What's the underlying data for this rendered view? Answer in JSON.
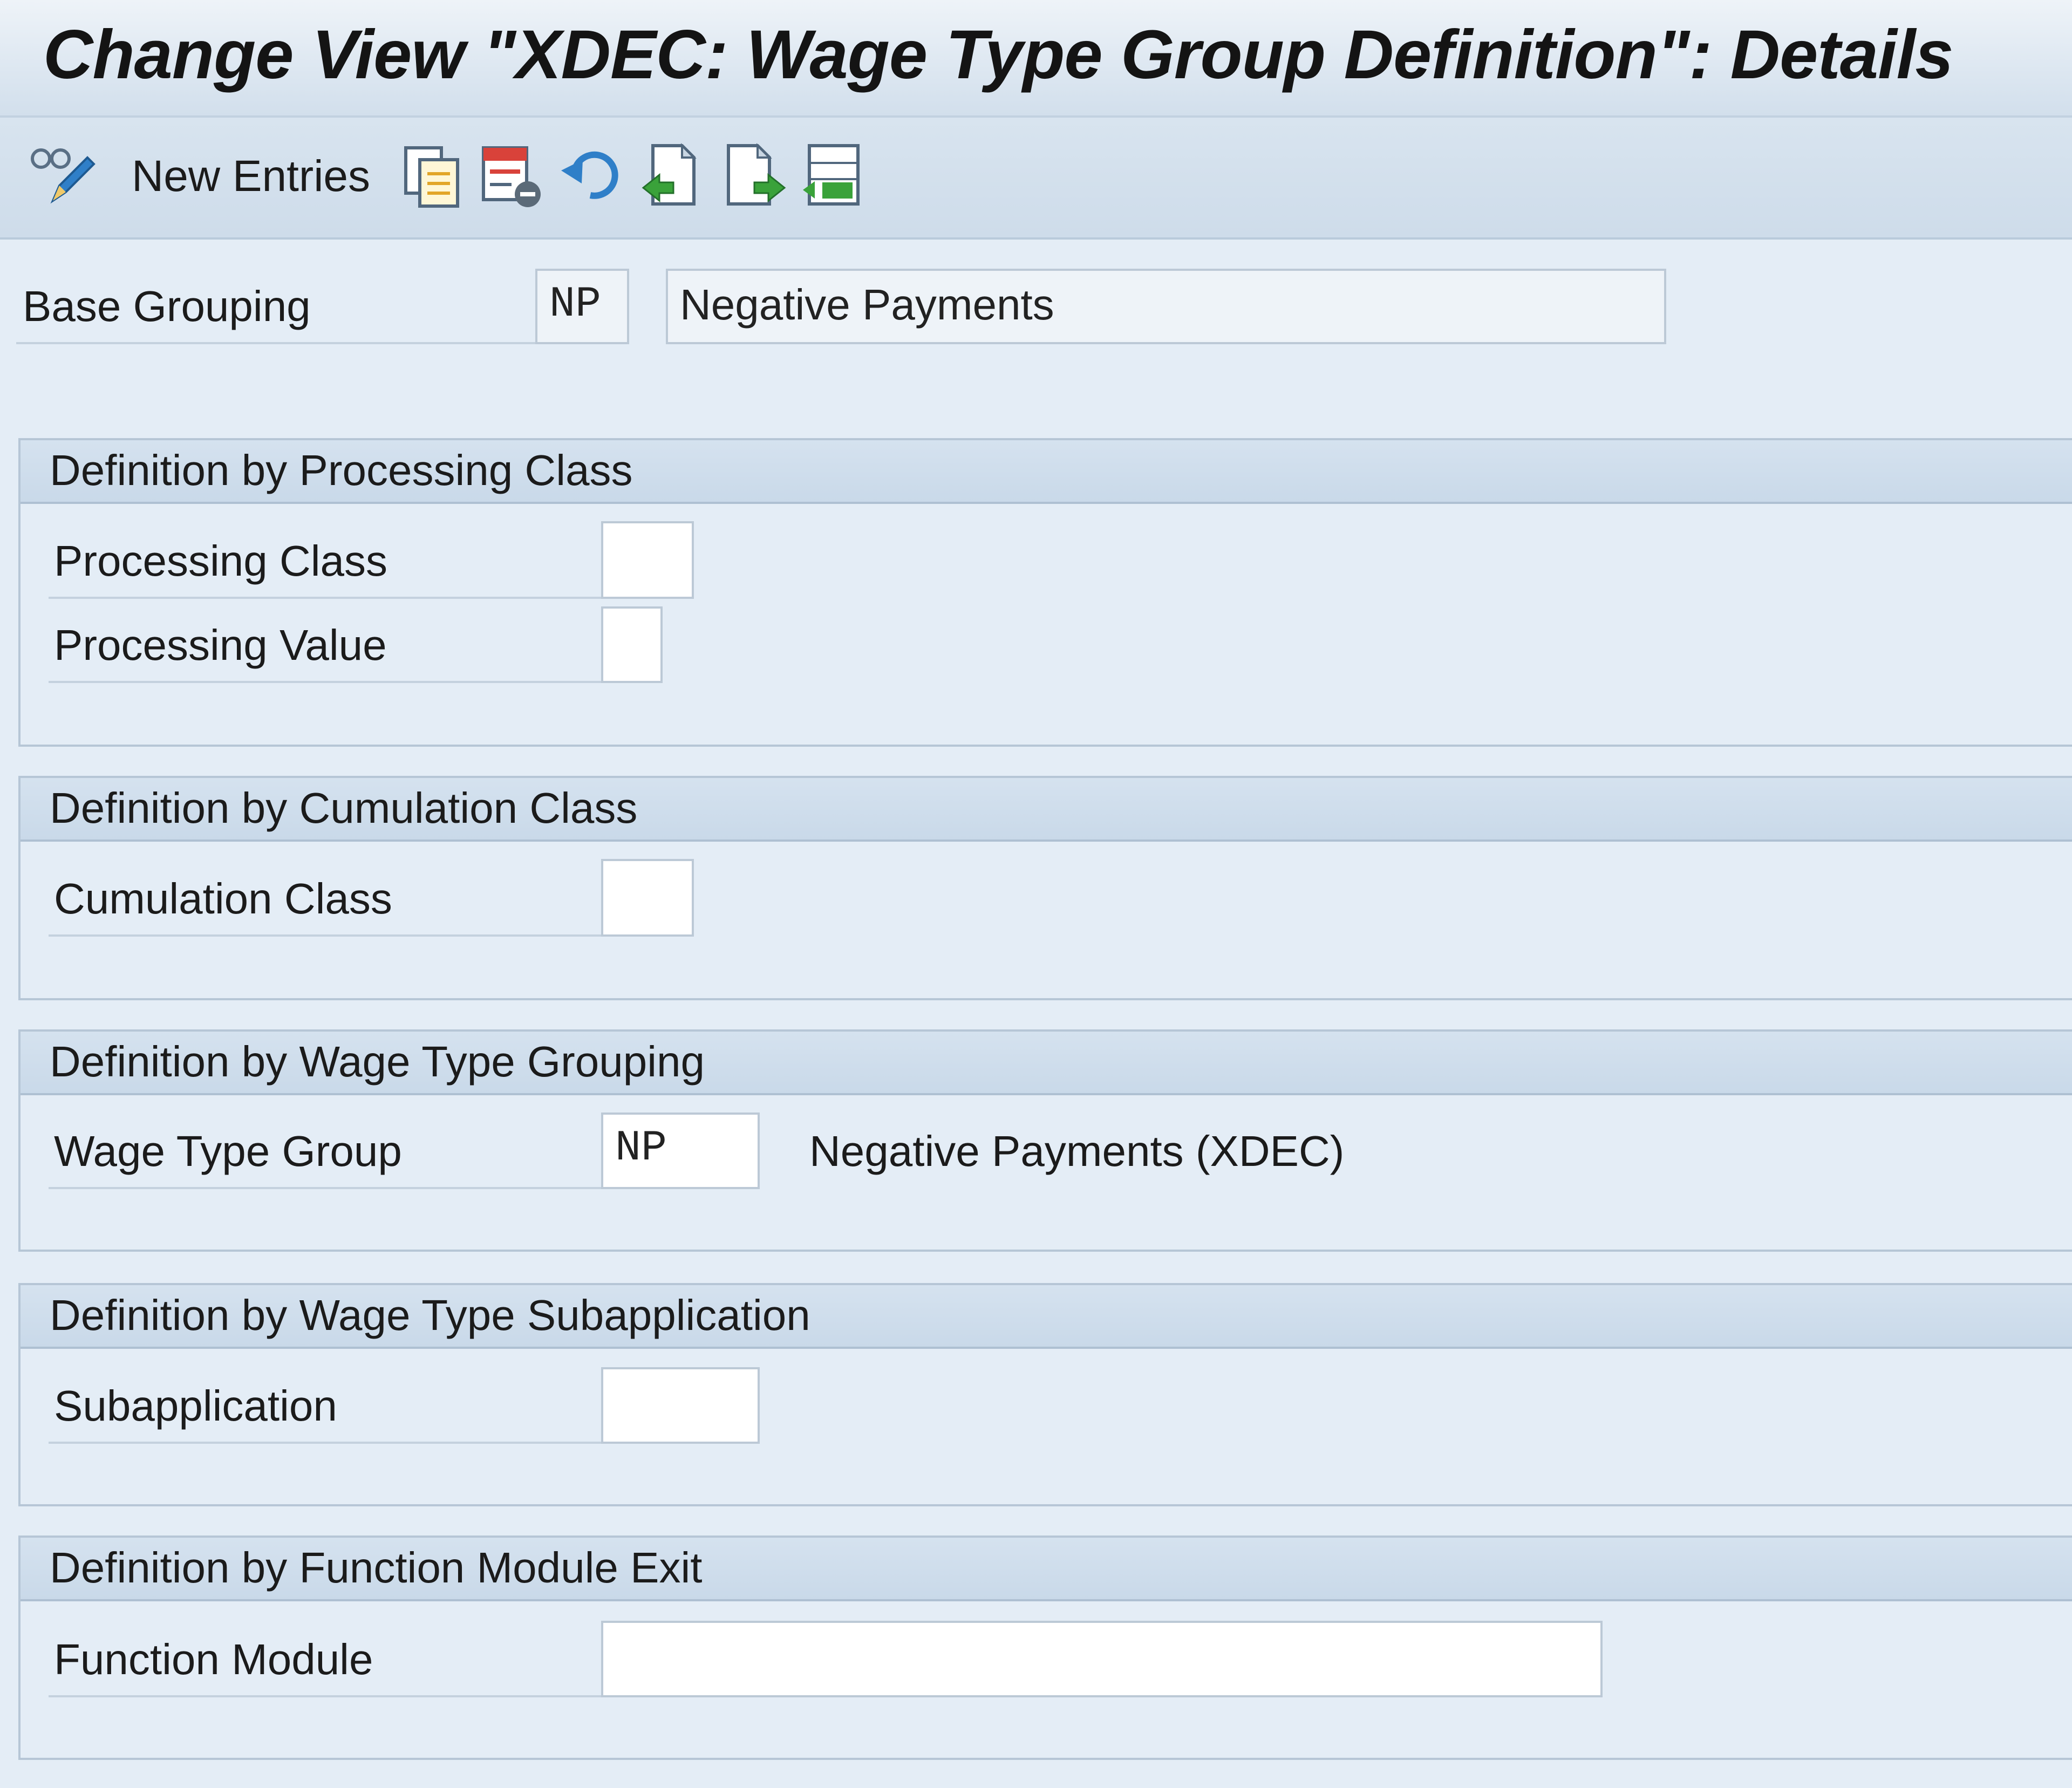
{
  "window": {
    "title": "Change View \"XDEC: Wage Type Group Definition\": Details"
  },
  "toolbar": {
    "new_entries_label": "New Entries",
    "icons": [
      "display-change-icon",
      "copy-as-icon",
      "delete-icon",
      "undo-change-icon",
      "previous-entry-icon",
      "next-entry-icon",
      "select-all-icon"
    ]
  },
  "header": {
    "base_grouping_label": "Base Grouping",
    "base_grouping_value": "NP",
    "base_grouping_text": "Negative Payments"
  },
  "processing_class_group": {
    "title": "Definition by Processing Class",
    "processing_class_label": "Processing Class",
    "processing_class_value": "",
    "processing_value_label": "Processing Value",
    "processing_value_value": ""
  },
  "cumulation_class_group": {
    "title": "Definition by Cumulation Class",
    "cumulation_class_label": "Cumulation Class",
    "cumulation_class_value": ""
  },
  "wage_type_grouping_group": {
    "title": "Definition by Wage Type Grouping",
    "wage_type_group_label": "Wage Type Group",
    "wage_type_group_value": "NP",
    "wage_type_group_text": "Negative Payments (XDEC)"
  },
  "subapplication_group": {
    "title": "Definition by Wage Type Subapplication",
    "subapplication_label": "Subapplication",
    "subapplication_value": ""
  },
  "function_module_group": {
    "title": "Definition by Function Module Exit",
    "function_module_label": "Function Module",
    "function_module_value": ""
  }
}
